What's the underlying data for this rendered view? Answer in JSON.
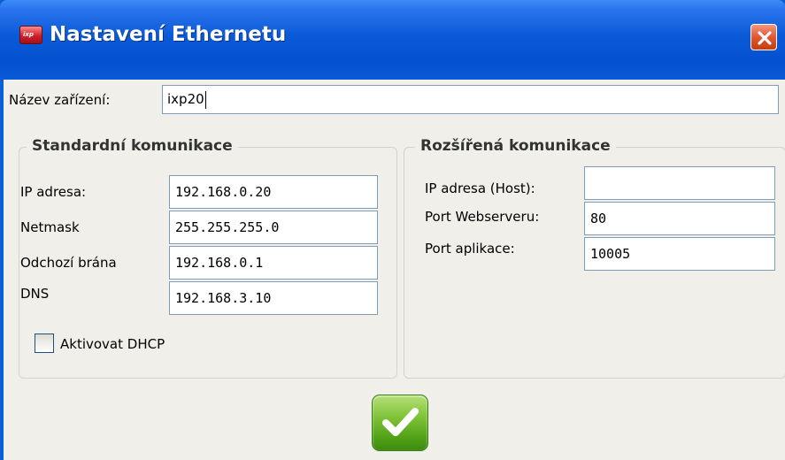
{
  "window": {
    "title": "Nastavení Ethernetu"
  },
  "device": {
    "name_label": "Název zařízení:",
    "name_value": "ixp20"
  },
  "standard": {
    "legend": "Standardní komunikace",
    "ip_label": "IP adresa:",
    "ip_value": "192.168.0.20",
    "netmask_label": "Netmask",
    "netmask_value": "255.255.255.0",
    "gateway_label": "Odchozí brána",
    "gateway_value": "192.168.0.1",
    "dns_label": "DNS",
    "dns_value": "192.168.3.10",
    "dhcp_label": "Aktivovat DHCP",
    "dhcp_checked": false
  },
  "extended": {
    "legend": "Rozšířená komunikace",
    "host_label": "IP adresa (Host):",
    "host_value": "",
    "webport_label": "Port Webserveru:",
    "webport_value": "80",
    "appport_label": "Port aplikace:",
    "appport_value": "10005"
  },
  "icons": {
    "app": "app-icon",
    "close": "close-icon",
    "confirm": "checkmark-icon"
  },
  "colors": {
    "titlebar": "#0a5ad8",
    "close": "#e2572f",
    "confirm": "#53a318"
  }
}
